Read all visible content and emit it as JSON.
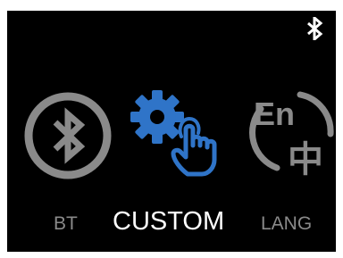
{
  "status_bar": {
    "icon": "bluetooth-icon"
  },
  "menu": {
    "items": [
      {
        "label": "BT",
        "icon": "bluetooth-circle-icon",
        "selected": false
      },
      {
        "label": "CUSTOM",
        "icon": "gear-touch-icon",
        "selected": true
      },
      {
        "label": "LANG",
        "icon": "language-en-zh-icon",
        "selected": false
      }
    ]
  },
  "colors": {
    "background": "#000000",
    "inactive": "#8a8a8a",
    "accent": "#2f74c8",
    "active_label": "#ffffff"
  },
  "language_icon_glyphs": {
    "top": "En",
    "bottom": "中"
  }
}
